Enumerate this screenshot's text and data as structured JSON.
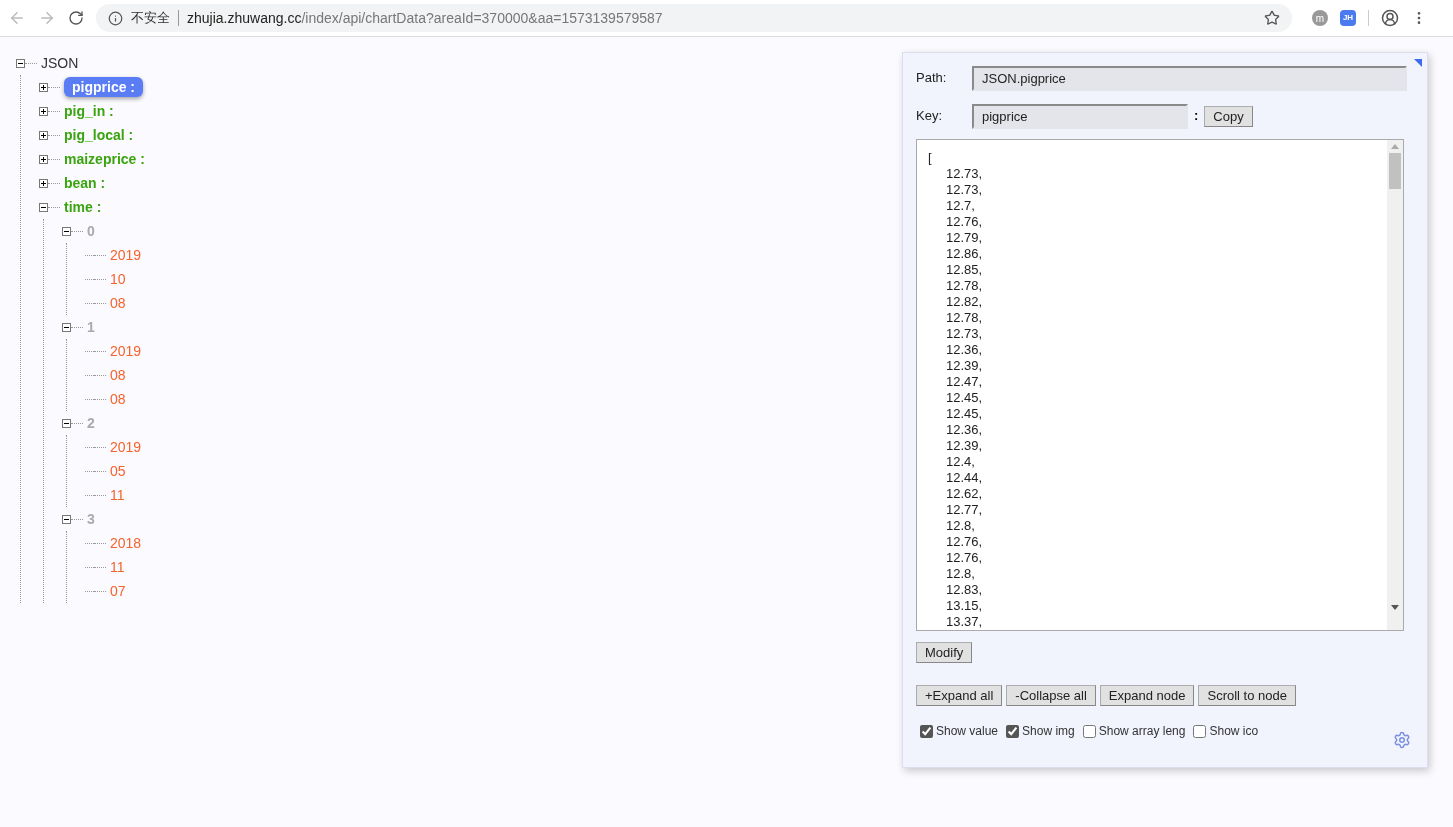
{
  "browser": {
    "security_label": "不安全",
    "url_host": "zhujia.zhuwang.cc",
    "url_path": "/index/api/chartData?areaId=370000&aa=1573139579587",
    "extensions": [
      "m",
      "JH"
    ]
  },
  "tree": {
    "label": "JSON",
    "kind": "root",
    "expanded": true,
    "selected": false,
    "children": [
      {
        "label": "pigprice :",
        "kind": "key",
        "expanded": false,
        "selected": true
      },
      {
        "label": "pig_in :",
        "kind": "key",
        "expanded": false,
        "selected": false
      },
      {
        "label": "pig_local :",
        "kind": "key",
        "expanded": false,
        "selected": false
      },
      {
        "label": "maizeprice :",
        "kind": "key",
        "expanded": false,
        "selected": false
      },
      {
        "label": "bean :",
        "kind": "key",
        "expanded": false,
        "selected": false
      },
      {
        "label": "time :",
        "kind": "key",
        "expanded": true,
        "selected": false,
        "children": [
          {
            "label": "0",
            "kind": "index",
            "expanded": true,
            "selected": false,
            "children": [
              {
                "label": "2019",
                "kind": "value",
                "selected": false
              },
              {
                "label": "10",
                "kind": "value",
                "selected": false
              },
              {
                "label": "08",
                "kind": "value",
                "selected": false
              }
            ]
          },
          {
            "label": "1",
            "kind": "index",
            "expanded": true,
            "selected": false,
            "children": [
              {
                "label": "2019",
                "kind": "value",
                "selected": false
              },
              {
                "label": "08",
                "kind": "value",
                "selected": false
              },
              {
                "label": "08",
                "kind": "value",
                "selected": false
              }
            ]
          },
          {
            "label": "2",
            "kind": "index",
            "expanded": true,
            "selected": false,
            "children": [
              {
                "label": "2019",
                "kind": "value",
                "selected": false
              },
              {
                "label": "05",
                "kind": "value",
                "selected": false
              },
              {
                "label": "11",
                "kind": "value",
                "selected": false
              }
            ]
          },
          {
            "label": "3",
            "kind": "index",
            "expanded": true,
            "selected": false,
            "children": [
              {
                "label": "2018",
                "kind": "value",
                "selected": false
              },
              {
                "label": "11",
                "kind": "value",
                "selected": false
              },
              {
                "label": "07",
                "kind": "value",
                "selected": false
              }
            ]
          }
        ]
      }
    ]
  },
  "panel": {
    "path_label": "Path:",
    "path_value": "JSON.pigprice",
    "key_label": "Key:",
    "key_value": "pigprice",
    "separator": ":",
    "copy_button": "Copy",
    "value_open": "[",
    "values": [
      "12.73,",
      "12.73,",
      "12.7,",
      "12.76,",
      "12.79,",
      "12.86,",
      "12.85,",
      "12.78,",
      "12.82,",
      "12.78,",
      "12.73,",
      "12.36,",
      "12.39,",
      "12.47,",
      "12.45,",
      "12.45,",
      "12.36,",
      "12.39,",
      "12.4,",
      "12.44,",
      "12.62,",
      "12.77,",
      "12.8,",
      "12.76,",
      "12.76,",
      "12.8,",
      "12.83,",
      "13.15,",
      "13.37,"
    ],
    "modify_button": "Modify",
    "buttons": [
      "+Expand all",
      "-Collapse all",
      "Expand node",
      "Scroll to node"
    ],
    "options": [
      {
        "label": "Show value",
        "checked": true
      },
      {
        "label": "Show img",
        "checked": true
      },
      {
        "label": "Show array leng",
        "checked": false
      },
      {
        "label": "Show ico",
        "checked": false
      }
    ]
  }
}
